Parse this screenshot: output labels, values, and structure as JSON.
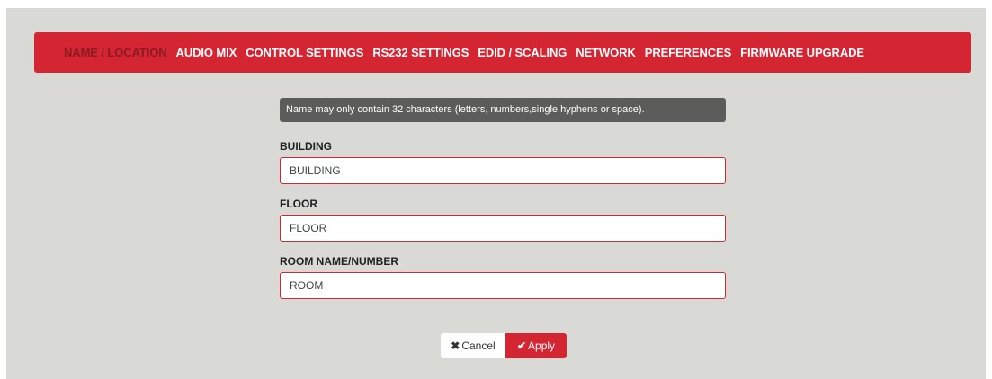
{
  "nav": {
    "items": [
      {
        "label": "NAME / LOCATION",
        "active": true
      },
      {
        "label": "AUDIO MIX",
        "active": false
      },
      {
        "label": "CONTROL SETTINGS",
        "active": false
      },
      {
        "label": "RS232 SETTINGS",
        "active": false
      },
      {
        "label": "EDID / SCALING",
        "active": false
      },
      {
        "label": "NETWORK",
        "active": false
      },
      {
        "label": "PREFERENCES",
        "active": false
      },
      {
        "label": "FIRMWARE UPGRADE",
        "active": false
      }
    ]
  },
  "form": {
    "hint": "Name may only contain 32 characters (letters, numbers,single hyphens or space).",
    "building": {
      "label": "BUILDING",
      "placeholder": "BUILDING",
      "value": ""
    },
    "floor": {
      "label": "FLOOR",
      "placeholder": "FLOOR",
      "value": ""
    },
    "room": {
      "label": "ROOM NAME/NUMBER",
      "placeholder": "ROOM",
      "value": ""
    }
  },
  "actions": {
    "cancel_label": "Cancel",
    "cancel_icon": "times-icon",
    "apply_label": "Apply",
    "apply_icon": "check-icon"
  },
  "colors": {
    "accent": "#d42533",
    "active_nav_text": "#8a1b22",
    "panel_background": "#d9d9d5",
    "hint_background": "#5c5c5a"
  }
}
